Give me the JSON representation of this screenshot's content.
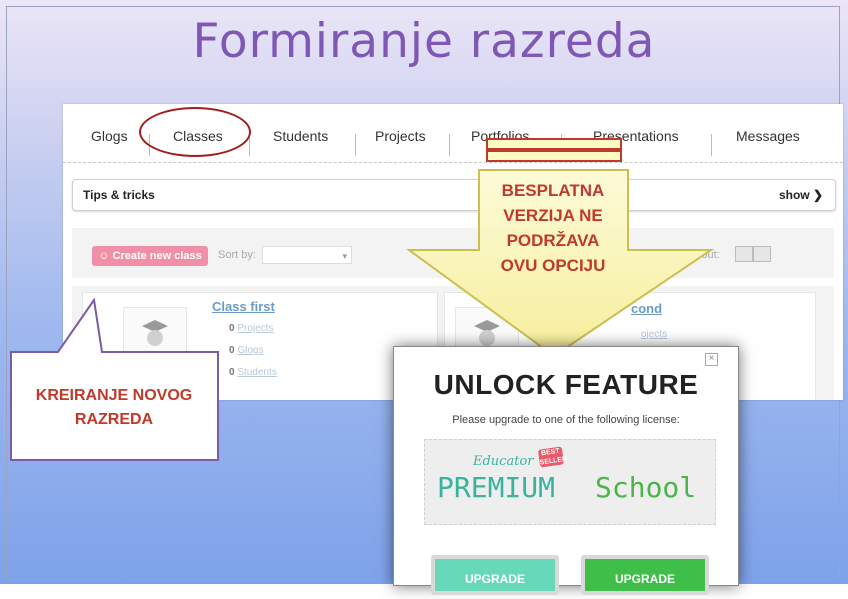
{
  "slide": {
    "title": "Formiranje razreda"
  },
  "tabs": [
    "Glogs",
    "Classes",
    "Students",
    "Projects",
    "Portfolios",
    "Presentations",
    "Messages"
  ],
  "tips": {
    "label": "Tips & tricks",
    "toggle": "show ❯"
  },
  "toolbar": {
    "new_class": "Create new class",
    "sort_label": "Sort by:",
    "sort_arrow": "▾",
    "layout_label": "ge layout:"
  },
  "classes": [
    {
      "name": "Class first",
      "projects": "0",
      "projects_label": "Projects",
      "glogs": "0",
      "glogs_label": "Glogs",
      "students": "0",
      "students_label": "Students"
    },
    {
      "name": "cond",
      "projects_label": "ojects"
    }
  ],
  "annotations": {
    "arrow_text": [
      "BESPLATNA",
      "VERZIJA NE",
      "PODRŽAVA",
      "OVU OPCIJU"
    ],
    "callout_text": [
      "KREIRANJE NOVOG",
      "RAZREDA"
    ]
  },
  "modal": {
    "close": "×",
    "title": "UNLOCK FEATURE",
    "subtitle": "Please upgrade to one of the following license:",
    "educator": "Educator",
    "best_seller": "BEST SELLER",
    "premium": "PREMIUM",
    "school": "School",
    "upgrade_1": "UPGRADE",
    "upgrade_2": "UPGRADE"
  },
  "colors": {
    "annotation": "#c0392b",
    "title": "#7f58b5",
    "premium": "#38b39d",
    "school": "#4bb549"
  }
}
